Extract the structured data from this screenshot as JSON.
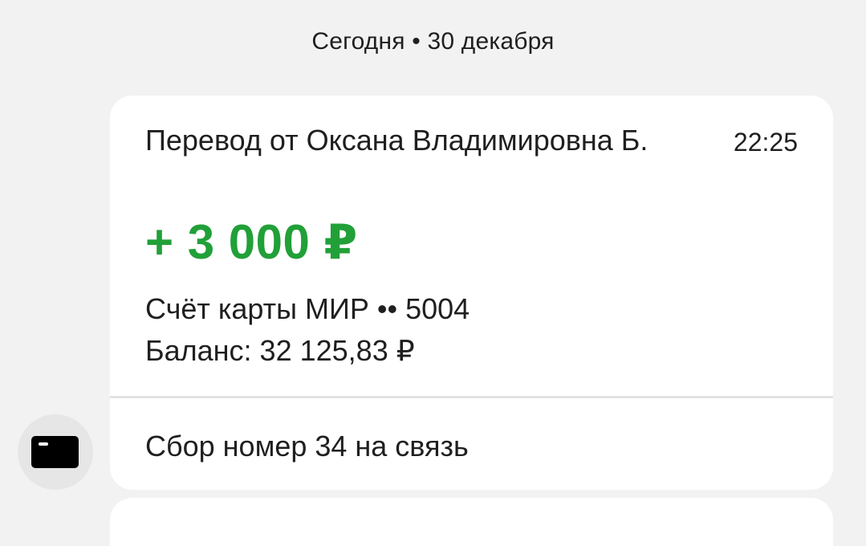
{
  "date_header": "Сегодня • 30 декабря",
  "transaction": {
    "title": "Перевод от Оксана Владимировна Б.",
    "time": "22:25",
    "amount": "+ 3 000 ₽",
    "account": "Счёт карты МИР •• 5004",
    "balance": "Баланс: 32 125,83 ₽",
    "message": "Сбор номер 34 на связь"
  },
  "icons": {
    "avatar": "bank-card-icon"
  },
  "colors": {
    "amount": "#21a038",
    "background": "#f2f2f2",
    "card": "#ffffff"
  }
}
